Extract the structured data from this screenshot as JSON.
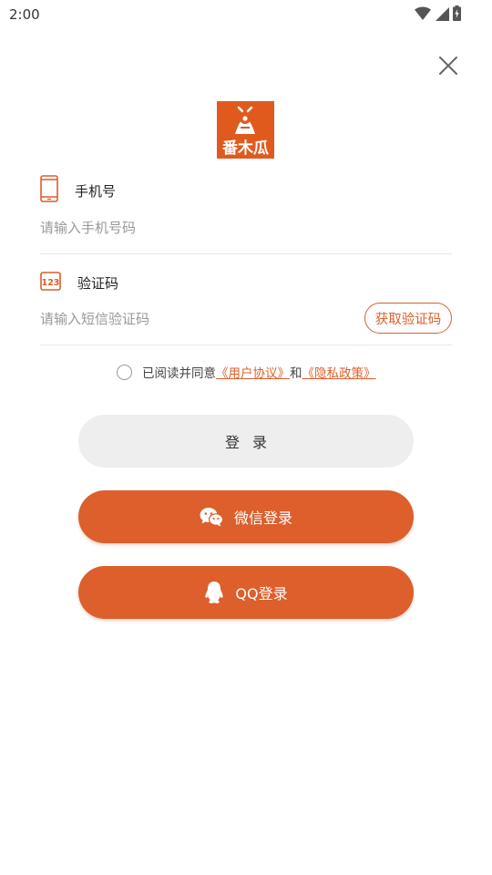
{
  "status_bar": {
    "time": "2:00",
    "icons": [
      "wifi-icon",
      "signal-icon",
      "battery-charging-icon"
    ]
  },
  "header": {
    "close_icon": "close-icon",
    "logo_text": "番木瓜"
  },
  "phone_field": {
    "icon": "phone-icon",
    "label": "手机号",
    "placeholder": "请输入手机号码",
    "value": ""
  },
  "code_field": {
    "icon": "number-code-icon",
    "label": "验证码",
    "placeholder": "请输入短信验证码",
    "value": "",
    "get_code_label": "获取验证码"
  },
  "agreement": {
    "checked": false,
    "prefix": "已阅读并同意",
    "user_agreement": "《用户协议》",
    "connector": "和",
    "privacy_policy": "《隐私政策》"
  },
  "buttons": {
    "login_label": "登录",
    "wechat_label": "微信登录",
    "wechat_icon": "wechat-icon",
    "qq_label": "QQ登录",
    "qq_icon": "qq-icon"
  },
  "colors": {
    "accent": "#dc5f2c",
    "login_button_bg": "#eeeeee",
    "placeholder": "#999999",
    "divider": "#e6e6e6"
  }
}
